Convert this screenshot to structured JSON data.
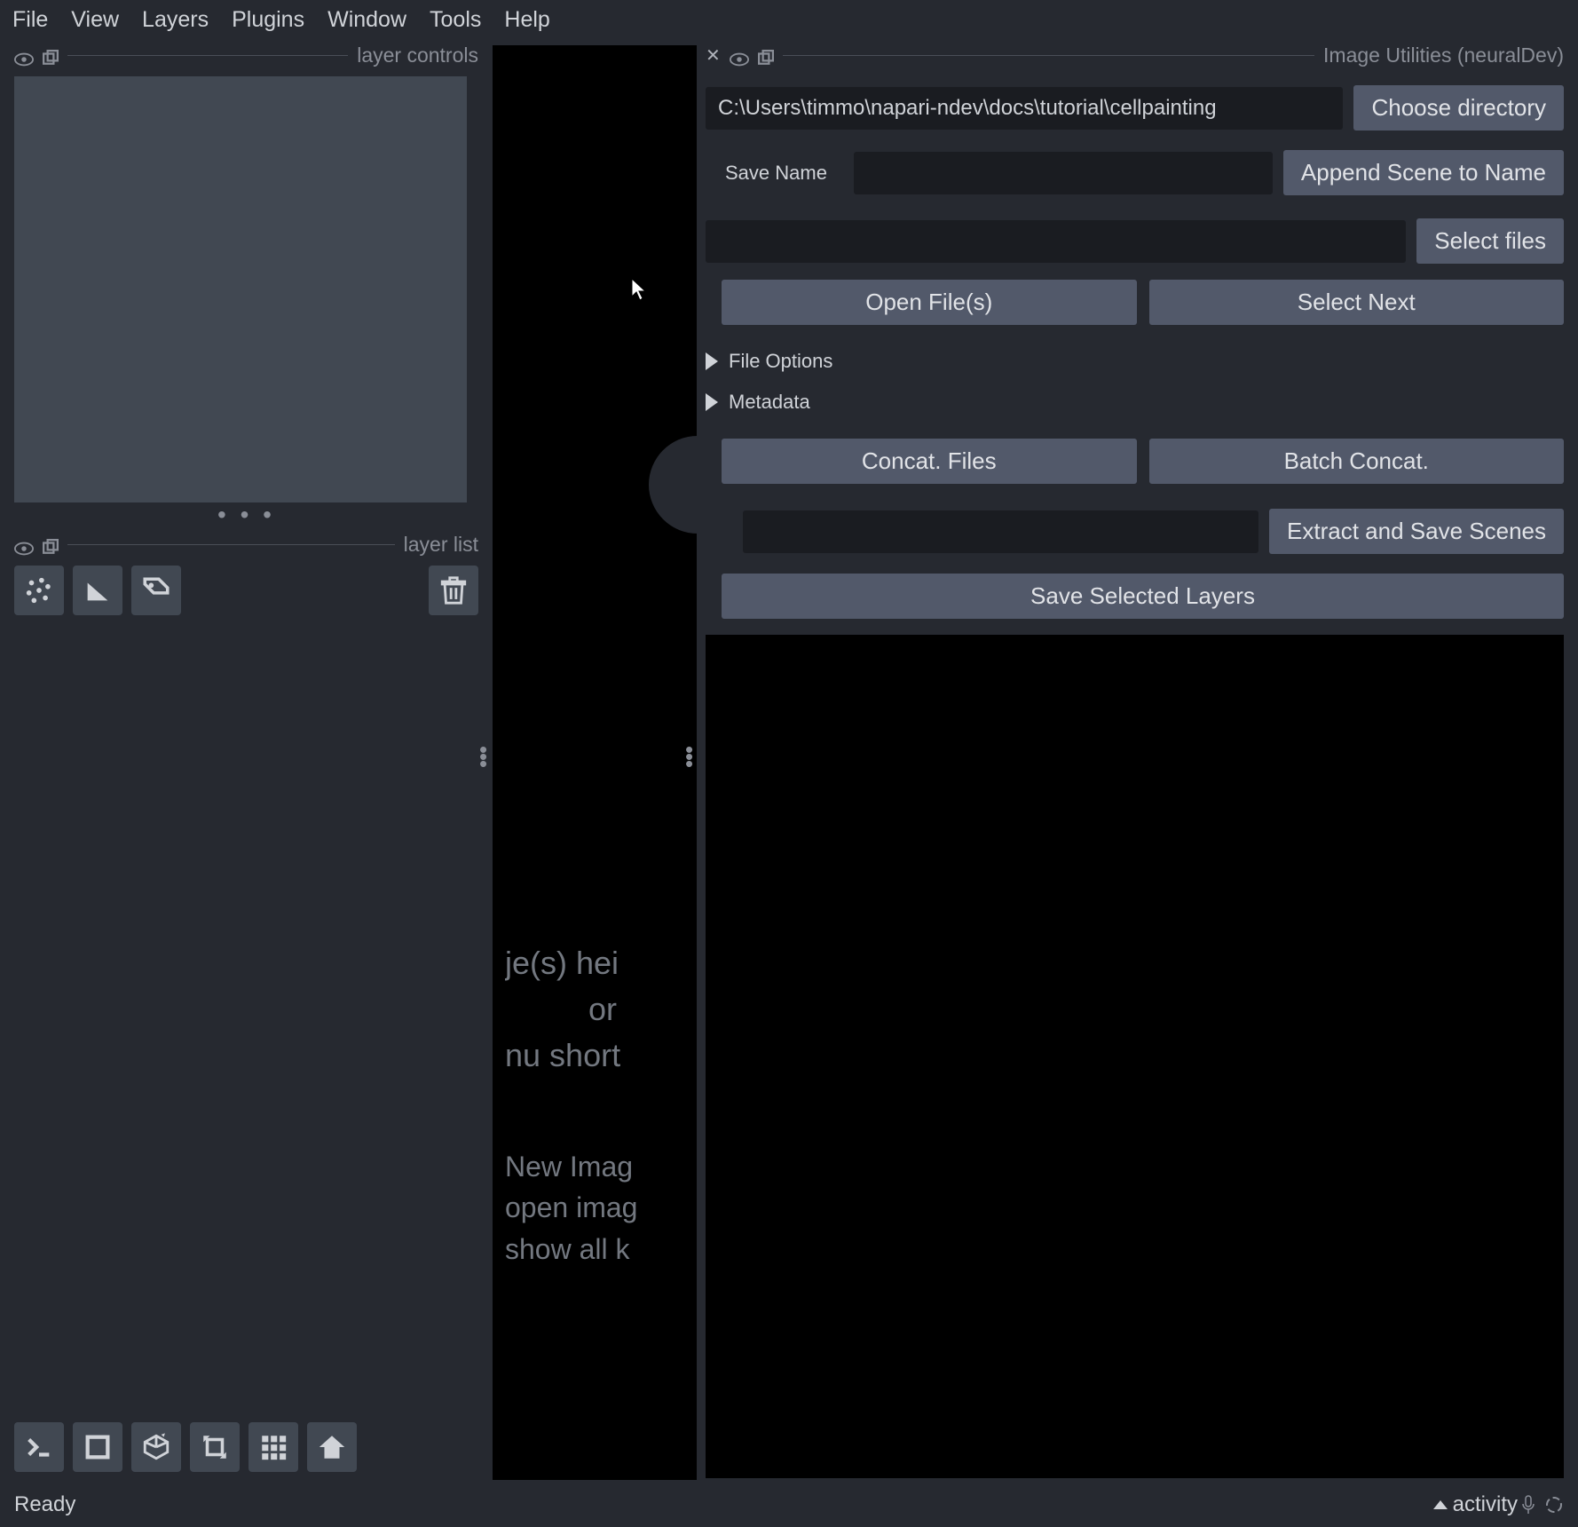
{
  "menu": [
    "File",
    "View",
    "Layers",
    "Plugins",
    "Window",
    "Tools",
    "Help"
  ],
  "left": {
    "layer_controls_title": "layer controls",
    "layer_list_title": "layer list"
  },
  "canvas": {
    "drop1": "je(s) hei",
    "drop2": "or",
    "drop3": "nu short",
    "hint1": "New Imag",
    "hint2": "open imag",
    "hint3": "show all k"
  },
  "right": {
    "panel_title": "Image Utilities (neuralDev)",
    "dir_path": "C:\\Users\\timmo\\napari-ndev\\docs\\tutorial\\cellpainting",
    "choose_dir": "Choose directory",
    "save_name_label": "Save Name",
    "append_scene": "Append Scene to Name",
    "select_files": "Select files",
    "open_files": "Open File(s)",
    "select_next": "Select Next",
    "file_options": "File Options",
    "metadata": "Metadata",
    "concat_files": "Concat. Files",
    "batch_concat": "Batch Concat.",
    "extract_save": "Extract and Save Scenes",
    "save_layers": "Save Selected Layers"
  },
  "status": {
    "ready": "Ready",
    "activity": "activity"
  }
}
